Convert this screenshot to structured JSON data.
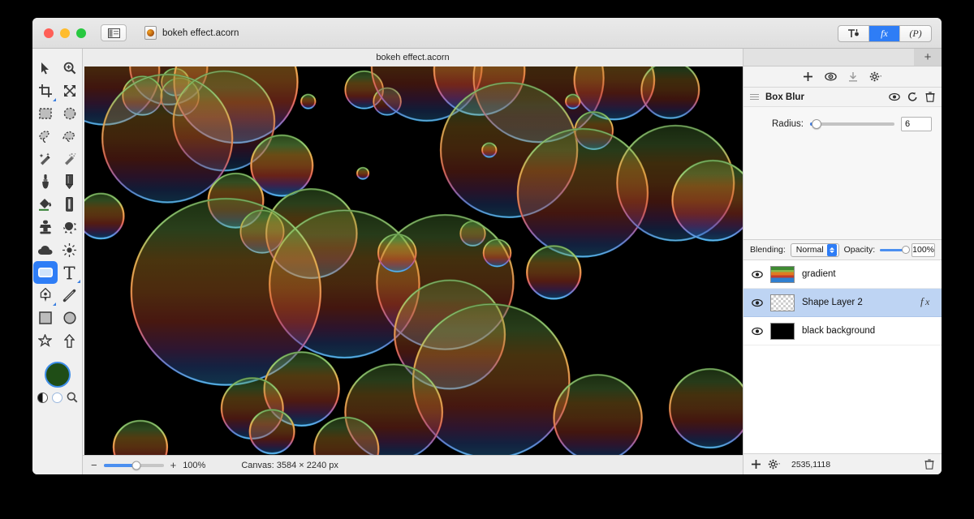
{
  "window": {
    "traffic_lights": [
      "close",
      "minimize",
      "maximize"
    ],
    "sidebar_toggle_name": "sidebar-toggle",
    "document_title": "bokeh effect.acorn",
    "document_subtitle": "bokeh effect.acorn"
  },
  "segmented": {
    "items": [
      {
        "label": "T",
        "name": "tool-options-button",
        "active": false
      },
      {
        "label": "fx",
        "name": "filters-button",
        "active": true
      },
      {
        "label": "(P)",
        "name": "palette-button",
        "active": false
      }
    ]
  },
  "tools": {
    "items": [
      {
        "name": "move-tool",
        "icon": "arrow-icon",
        "selected": false
      },
      {
        "name": "zoom-tool",
        "icon": "magnifier-plus-icon",
        "selected": false
      },
      {
        "name": "crop-tool",
        "icon": "crop-icon",
        "selected": false
      },
      {
        "name": "transform-tool",
        "icon": "move-arrows-icon",
        "selected": false
      },
      {
        "name": "rectangular-select-tool",
        "icon": "marquee-rect-icon",
        "selected": false
      },
      {
        "name": "elliptical-select-tool",
        "icon": "marquee-ellipse-icon",
        "selected": false
      },
      {
        "name": "lasso-tool",
        "icon": "lasso-icon",
        "selected": false
      },
      {
        "name": "polygon-lasso-tool",
        "icon": "polygon-lasso-icon",
        "selected": false
      },
      {
        "name": "magic-wand-tool",
        "icon": "magic-wand-icon",
        "selected": false
      },
      {
        "name": "instant-alpha-tool",
        "icon": "sparkle-wand-icon",
        "selected": false
      },
      {
        "name": "brush-tool",
        "icon": "paintbrush-icon",
        "selected": false
      },
      {
        "name": "pencil-tool",
        "icon": "pencil-icon",
        "selected": false
      },
      {
        "name": "paint-bucket-tool",
        "icon": "paint-bucket-icon",
        "selected": false
      },
      {
        "name": "eraser-tool",
        "icon": "eraser-icon",
        "selected": false
      },
      {
        "name": "clone-stamp-tool",
        "icon": "clone-stamp-icon",
        "selected": false
      },
      {
        "name": "smudge-tool",
        "icon": "smudge-icon",
        "selected": false
      },
      {
        "name": "blur-tool",
        "icon": "cloud-icon",
        "selected": false
      },
      {
        "name": "dodge-tool",
        "icon": "sun-icon",
        "selected": false
      },
      {
        "name": "rounded-rectangle-shape-tool",
        "icon": "rounded-rect-icon",
        "selected": true
      },
      {
        "name": "text-tool",
        "icon": "text-t-icon",
        "selected": false
      },
      {
        "name": "bezier-pen-tool",
        "icon": "pen-nib-icon",
        "selected": false
      },
      {
        "name": "line-tool",
        "icon": "line-icon",
        "selected": false
      },
      {
        "name": "rectangle-shape-tool",
        "icon": "square-icon",
        "selected": false
      },
      {
        "name": "ellipse-shape-tool",
        "icon": "circle-icon",
        "selected": false
      },
      {
        "name": "star-shape-tool",
        "icon": "star-icon",
        "selected": false
      },
      {
        "name": "arrow-shape-tool",
        "icon": "arrow-up-icon",
        "selected": false
      }
    ],
    "foreground_color": "#1f4d16",
    "swatch_ring_color": "#3e8de8"
  },
  "statusbar": {
    "zoom_minus": "−",
    "zoom_plus": "+",
    "zoom_level": "100%",
    "canvas_size": "Canvas: 3584 × 2240 px"
  },
  "right_panel": {
    "add_tab_label": "+",
    "toolbar_icons": [
      {
        "name": "add-filter-icon",
        "label": "+"
      },
      {
        "name": "preview-eye-icon",
        "label": "◎"
      },
      {
        "name": "download-icon",
        "label": "↓"
      },
      {
        "name": "gear-menu-icon",
        "label": "⚙"
      }
    ],
    "filter": {
      "title": "Box Blur",
      "header_icons": [
        "eye-icon",
        "reset-icon",
        "trash-icon"
      ],
      "param_label": "Radius:",
      "param_value": "6",
      "slider_percent": 8
    },
    "layers_header": {
      "blending_label": "Blending:",
      "blending_value": "Normal",
      "opacity_label": "Opacity:",
      "opacity_value": "100%",
      "opacity_percent": 100
    },
    "layers": [
      {
        "name": "gradient",
        "thumb": "gradient",
        "visible": true,
        "selected": false,
        "has_fx": false
      },
      {
        "name": "Shape Layer 2",
        "thumb": "checker",
        "visible": true,
        "selected": true,
        "has_fx": true
      },
      {
        "name": "black background",
        "thumb": "black",
        "visible": true,
        "selected": false,
        "has_fx": false
      }
    ],
    "footer": {
      "add_label": "+",
      "gear_label": "⚙",
      "coordinates": "2535,1118",
      "trash_name": "delete-layer-icon"
    }
  },
  "artwork": {
    "description": "bokeh effect: translucent overlapping circles over black with vertical green-orange-red-blue gradient",
    "background": "#000000",
    "gradient_stops": [
      {
        "offset": 0.0,
        "color": "#4e8a33"
      },
      {
        "offset": 0.17,
        "color": "#7bb950"
      },
      {
        "offset": 0.33,
        "color": "#d79a2b"
      },
      {
        "offset": 0.5,
        "color": "#e07b2a"
      },
      {
        "offset": 0.66,
        "color": "#d2452f"
      },
      {
        "offset": 0.8,
        "color": "#8a3f8d"
      },
      {
        "offset": 0.9,
        "color": "#3a63c0"
      },
      {
        "offset": 1.0,
        "color": "#2f9fe0"
      }
    ],
    "circles": [
      {
        "cx": 0.03,
        "cy": 0.01,
        "r": 0.085,
        "a": 0.55
      },
      {
        "cx": 0.128,
        "cy": 0.0,
        "r": 0.06,
        "a": 0.52
      },
      {
        "cx": 0.088,
        "cy": 0.075,
        "r": 0.031,
        "a": 0.7
      },
      {
        "cx": 0.138,
        "cy": 0.04,
        "r": 0.022,
        "a": 0.72
      },
      {
        "cx": 0.145,
        "cy": 0.078,
        "r": 0.03,
        "a": 0.48
      },
      {
        "cx": 0.23,
        "cy": 0.04,
        "r": 0.095,
        "a": 0.78
      },
      {
        "cx": 0.212,
        "cy": 0.14,
        "r": 0.078,
        "a": 0.46
      },
      {
        "cx": 0.126,
        "cy": 0.185,
        "r": 0.1,
        "a": 0.52
      },
      {
        "cx": 0.3,
        "cy": 0.255,
        "r": 0.048,
        "a": 0.9
      },
      {
        "cx": 0.23,
        "cy": 0.345,
        "r": 0.043,
        "a": 0.75
      },
      {
        "cx": 0.025,
        "cy": 0.385,
        "r": 0.036,
        "a": 0.72
      },
      {
        "cx": 0.27,
        "cy": 0.425,
        "r": 0.034,
        "a": 0.78
      },
      {
        "cx": 0.34,
        "cy": 0.09,
        "r": 0.012,
        "a": 0.8
      },
      {
        "cx": 0.423,
        "cy": 0.275,
        "r": 0.01,
        "a": 0.85
      },
      {
        "cx": 0.425,
        "cy": 0.06,
        "r": 0.03,
        "a": 0.72
      },
      {
        "cx": 0.46,
        "cy": 0.09,
        "r": 0.022,
        "a": 0.62
      },
      {
        "cx": 0.52,
        "cy": 0.0,
        "r": 0.085,
        "a": 0.52
      },
      {
        "cx": 0.6,
        "cy": 0.01,
        "r": 0.07,
        "a": 0.66
      },
      {
        "cx": 0.69,
        "cy": 0.03,
        "r": 0.1,
        "a": 0.5
      },
      {
        "cx": 0.805,
        "cy": 0.035,
        "r": 0.062,
        "a": 0.62
      },
      {
        "cx": 0.742,
        "cy": 0.09,
        "r": 0.012,
        "a": 0.8
      },
      {
        "cx": 0.89,
        "cy": 0.06,
        "r": 0.045,
        "a": 0.52
      },
      {
        "cx": 0.645,
        "cy": 0.215,
        "r": 0.105,
        "a": 0.52
      },
      {
        "cx": 0.774,
        "cy": 0.165,
        "r": 0.03,
        "a": 0.7
      },
      {
        "cx": 0.615,
        "cy": 0.215,
        "r": 0.012,
        "a": 0.8
      },
      {
        "cx": 0.757,
        "cy": 0.325,
        "r": 0.1,
        "a": 0.58
      },
      {
        "cx": 0.898,
        "cy": 0.3,
        "r": 0.09,
        "a": 0.52
      },
      {
        "cx": 0.955,
        "cy": 0.345,
        "r": 0.063,
        "a": 0.68
      },
      {
        "cx": 0.59,
        "cy": 0.43,
        "r": 0.02,
        "a": 0.74
      },
      {
        "cx": 0.345,
        "cy": 0.43,
        "r": 0.07,
        "a": 0.62
      },
      {
        "cx": 0.395,
        "cy": 0.56,
        "r": 0.115,
        "a": 0.58
      },
      {
        "cx": 0.548,
        "cy": 0.555,
        "r": 0.105,
        "a": 0.56
      },
      {
        "cx": 0.475,
        "cy": 0.48,
        "r": 0.03,
        "a": 0.74
      },
      {
        "cx": 0.627,
        "cy": 0.48,
        "r": 0.022,
        "a": 0.8
      },
      {
        "cx": 0.713,
        "cy": 0.53,
        "r": 0.042,
        "a": 0.72
      },
      {
        "cx": 0.215,
        "cy": 0.58,
        "r": 0.145,
        "a": 0.62
      },
      {
        "cx": 0.555,
        "cy": 0.69,
        "r": 0.085,
        "a": 0.58
      },
      {
        "cx": 0.618,
        "cy": 0.81,
        "r": 0.12,
        "a": 0.6
      },
      {
        "cx": 0.33,
        "cy": 0.83,
        "r": 0.058,
        "a": 0.68
      },
      {
        "cx": 0.255,
        "cy": 0.88,
        "r": 0.048,
        "a": 0.62
      },
      {
        "cx": 0.285,
        "cy": 0.94,
        "r": 0.035,
        "a": 0.66
      },
      {
        "cx": 0.085,
        "cy": 0.98,
        "r": 0.042,
        "a": 0.7
      },
      {
        "cx": 0.47,
        "cy": 0.89,
        "r": 0.075,
        "a": 0.58
      },
      {
        "cx": 0.78,
        "cy": 0.905,
        "r": 0.068,
        "a": 0.58
      },
      {
        "cx": 0.95,
        "cy": 0.88,
        "r": 0.062,
        "a": 0.58
      },
      {
        "cx": 0.398,
        "cy": 0.985,
        "r": 0.05,
        "a": 0.62
      }
    ]
  }
}
